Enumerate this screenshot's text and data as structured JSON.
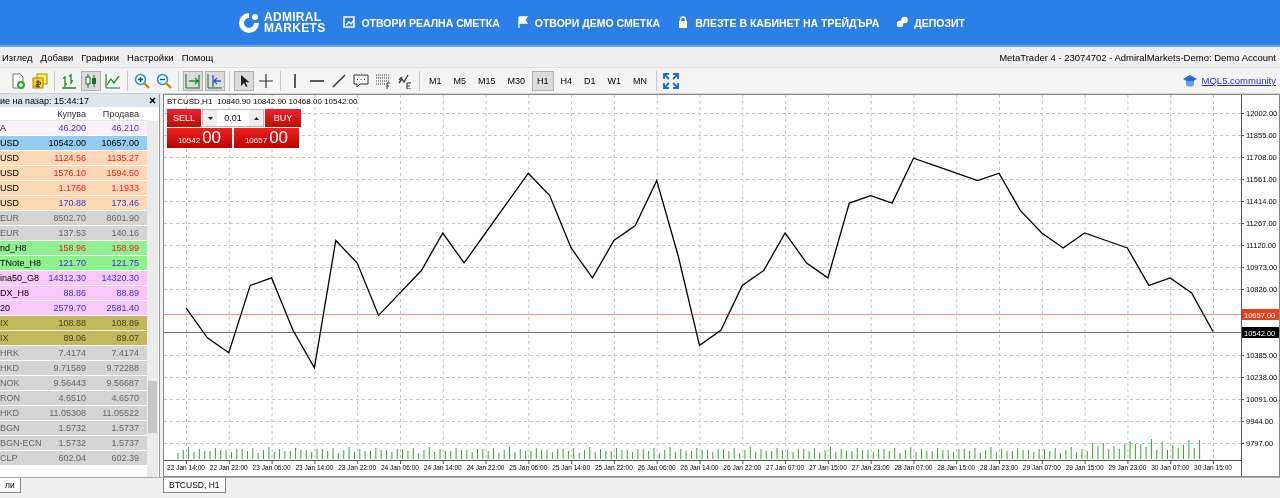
{
  "header": {
    "logo": [
      "ADMIRAL",
      "MARKETS"
    ],
    "nav": [
      {
        "label": "ОТВОРИ РЕАЛНА СМЕТКА"
      },
      {
        "label": "ОТВОРИ ДЕМО СМЕТКА"
      },
      {
        "label": "ВЛЕЗТЕ В КАБИНЕТ НА ТРЕЙДЪРА"
      },
      {
        "label": "ДЕПОЗИТ"
      }
    ]
  },
  "menu": [
    "Изглед",
    "Добави",
    "Графики",
    "Настройки",
    "Помощ"
  ],
  "window_title": "MetaTrader 4 - 23074702 - AdmiralMarkets-Demo: Demo Account",
  "toolbar": {
    "tool_groups": [
      [
        {
          "kind": "new_chart",
          "selected": false
        },
        {
          "kind": "profiles",
          "selected": false
        }
      ],
      [
        {
          "kind": "bars",
          "selected": false
        },
        {
          "kind": "candles",
          "selected": true
        },
        {
          "kind": "line",
          "selected": false
        }
      ],
      [
        {
          "kind": "zoom_in",
          "selected": false
        },
        {
          "kind": "zoom_out",
          "selected": false
        }
      ],
      [
        {
          "kind": "autoscroll",
          "selected": true
        },
        {
          "kind": "shift",
          "selected": true
        }
      ],
      [
        {
          "kind": "cursor",
          "selected": true
        },
        {
          "kind": "crosshair",
          "selected": false
        }
      ],
      [
        {
          "kind": "vline",
          "selected": false
        },
        {
          "kind": "hline",
          "selected": false
        },
        {
          "kind": "trendline",
          "selected": false
        },
        {
          "kind": "text",
          "selected": false
        },
        {
          "kind": "fibo",
          "selected": false
        },
        {
          "kind": "elliott",
          "selected": false
        }
      ]
    ],
    "timeframes": [
      {
        "label": "M1",
        "selected": false
      },
      {
        "label": "M5",
        "selected": false
      },
      {
        "label": "M15",
        "selected": false
      },
      {
        "label": "M30",
        "selected": false
      },
      {
        "label": "H1",
        "selected": true
      },
      {
        "label": "H4",
        "selected": false
      },
      {
        "label": "D1",
        "selected": false
      },
      {
        "label": "W1",
        "selected": false
      },
      {
        "label": "MN",
        "selected": false
      }
    ],
    "community_link": "MQL5.community"
  },
  "market_watch": {
    "title": "ие на пазар: 15:44:17",
    "columns": [
      "Купува",
      "Продава"
    ],
    "rows": [
      {
        "symbol": "A",
        "bid": "46.200",
        "ask": "46.210",
        "kind": "rise",
        "color": "#fdf0fd",
        "selected": false
      },
      {
        "symbol": "USD",
        "bid": "10542.00",
        "ask": "10657.00",
        "kind": "plain",
        "selected": true
      },
      {
        "symbol": "USD",
        "bid": "1124.56",
        "ask": "1135.27",
        "kind": "fall",
        "color": "#ffd9b5",
        "selected": false
      },
      {
        "symbol": "USD",
        "bid": "1576.10",
        "ask": "1594.50",
        "kind": "fall",
        "color": "#ffd9b5",
        "selected": false
      },
      {
        "symbol": "USD",
        "bid": "1.1768",
        "ask": "1.1933",
        "kind": "fall",
        "color": "#ffd9b5",
        "selected": false
      },
      {
        "symbol": "USD",
        "bid": "170.88",
        "ask": "173.46",
        "kind": "rise",
        "color": "#ffd9b5",
        "selected": false
      },
      {
        "symbol": "EUR",
        "bid": "8502.70",
        "ask": "8601.90",
        "kind": "closed",
        "color": "#d4d4d4",
        "selected": false
      },
      {
        "symbol": "EUR",
        "bid": "137.53",
        "ask": "140.16",
        "kind": "closed",
        "color": "#d4d4d4",
        "selected": false
      },
      {
        "symbol": "nd_H8",
        "bid": "158.96",
        "ask": "158.99",
        "kind": "fall",
        "color": "#8ff08f",
        "selected": false
      },
      {
        "symbol": "TNote_H8",
        "bid": "121.70",
        "ask": "121.75",
        "kind": "rise",
        "color": "#8ff08f",
        "selected": false
      },
      {
        "symbol": "ina50_G8",
        "bid": "14312.30",
        "ask": "14320.30",
        "kind": "rise",
        "color": "#f8c8f8",
        "selected": false
      },
      {
        "symbol": "DX_H8",
        "bid": "88.86",
        "ask": "88.89",
        "kind": "rise",
        "color": "#f8c8f8",
        "selected": false
      },
      {
        "symbol": "20",
        "bid": "2579.70",
        "ask": "2581.40",
        "kind": "rise",
        "color": "#f8c8f8",
        "selected": false
      },
      {
        "symbol": "IX",
        "bid": "108.88",
        "ask": "108.89",
        "kind": "faded",
        "color": "#c4b85c",
        "selected": false
      },
      {
        "symbol": "IX",
        "bid": "89.06",
        "ask": "89.07",
        "kind": "faded",
        "color": "#c4b85c",
        "selected": false
      },
      {
        "symbol": "HRK",
        "bid": "7.4174",
        "ask": "7.4174",
        "kind": "closed",
        "color": "#d4d4d4",
        "selected": false
      },
      {
        "symbol": "HKD",
        "bid": "9.71589",
        "ask": "9.72288",
        "kind": "closed",
        "color": "#d4d4d4",
        "selected": false
      },
      {
        "symbol": "NOK",
        "bid": "9.56443",
        "ask": "9.56687",
        "kind": "closed",
        "color": "#d4d4d4",
        "selected": false
      },
      {
        "symbol": "RON",
        "bid": "4.6510",
        "ask": "4.6570",
        "kind": "closed",
        "color": "#d4d4d4",
        "selected": false
      },
      {
        "symbol": "HKD",
        "bid": "11.05308",
        "ask": "11.05522",
        "kind": "closed",
        "color": "#d4d4d4",
        "selected": false
      },
      {
        "symbol": "BGN",
        "bid": "1.5732",
        "ask": "1.5737",
        "kind": "closed",
        "color": "#d4d4d4",
        "selected": false
      },
      {
        "symbol": "BGN-ECN",
        "bid": "1.5732",
        "ask": "1.5737",
        "kind": "closed",
        "color": "#d4d4d4",
        "selected": false
      },
      {
        "symbol": "CLP",
        "bid": "602.04",
        "ask": "602.39",
        "kind": "closed",
        "color": "#d4d4d4",
        "selected": false
      }
    ]
  },
  "chart": {
    "symbol": "BTCUSD,H1",
    "ohlc": [
      "10840.90",
      "10842.90",
      "10468.00",
      "10542.00"
    ],
    "trade_panel": {
      "sell_label": "SELL",
      "buy_label": "BUY",
      "lot": "0.01",
      "sell_price": [
        "10542",
        "00"
      ],
      "buy_price": [
        "10657",
        "00"
      ]
    },
    "chart_data": {
      "type": "line",
      "grid": true,
      "ylim": [
        9684,
        12122
      ],
      "categories": [
        "22 Jan 14:00",
        null,
        "22 Jan 22:00",
        null,
        "23 Jan 06:00",
        null,
        "23 Jan 14:00",
        null,
        "23 Jan 22:00",
        null,
        "24 Jan 06:00",
        null,
        "24 Jan 14:00",
        null,
        "24 Jan 22:00",
        null,
        "25 Jan 06:00",
        null,
        "25 Jan 14:00",
        null,
        "25 Jan 22:00",
        null,
        "26 Jan 06:00",
        null,
        "26 Jan 14:00",
        null,
        "26 Jan 22:00",
        null,
        "27 Jan 07:00",
        null,
        "27 Jan 15:00",
        null,
        "27 Jan 23:00",
        null,
        "28 Jan 07:00",
        null,
        "28 Jan 15:00",
        null,
        "28 Jan 23:00",
        null,
        "29 Jan 07:00",
        null,
        "29 Jan 15:00",
        null,
        "29 Jan 23:00",
        null,
        "30 Jan 07:00",
        null,
        "30 Jan 15:00"
      ],
      "series": [
        {
          "color": "#000000",
          "values": [
            10700,
            10500,
            10400,
            10850,
            10900,
            10550,
            10300,
            11150,
            11000,
            10650,
            10800,
            10950,
            11200,
            11000,
            11200,
            11400,
            11600,
            11450,
            11100,
            10900,
            11150,
            11250,
            11550,
            11050,
            10450,
            10550,
            10850,
            10950,
            11200,
            11000,
            10900,
            11400,
            11450,
            11400,
            11700,
            11650,
            11600,
            11550,
            11600,
            11350,
            11200,
            11100,
            11200,
            11150,
            11100,
            10850,
            10900,
            10800,
            10542
          ]
        }
      ],
      "yticks": [
        {
          "value": 12002,
          "label": "12002.00"
        },
        {
          "value": 11855,
          "label": "11855.00"
        },
        {
          "value": 11708,
          "label": "11708.00"
        },
        {
          "value": 11561,
          "label": "11561.00"
        },
        {
          "value": 11414,
          "label": "11414.00"
        },
        {
          "value": 11267,
          "label": "11267.00"
        },
        {
          "value": 11120,
          "label": "11120.00"
        },
        {
          "value": 10973,
          "label": "10973.00"
        },
        {
          "value": 10826,
          "label": "10826.00"
        },
        {
          "value": 10385,
          "label": "10385.00"
        },
        {
          "value": 10238,
          "label": "10238.00"
        },
        {
          "value": 10091,
          "label": "10091.00"
        },
        {
          "value": 9944,
          "label": "9944.00"
        },
        {
          "value": 9797,
          "label": "9797.00"
        }
      ],
      "ref_lines": [
        {
          "axis": "y",
          "value": 10657,
          "label": "10657.00",
          "color": "#e8401c"
        },
        {
          "axis": "y",
          "value": 10542,
          "label": "10542.00",
          "color": "#000000"
        }
      ]
    },
    "tab": {
      "label": "BTCUSD, H1",
      "selected": true
    }
  },
  "panel_tab": {
    "label": "ли",
    "selected": true
  }
}
